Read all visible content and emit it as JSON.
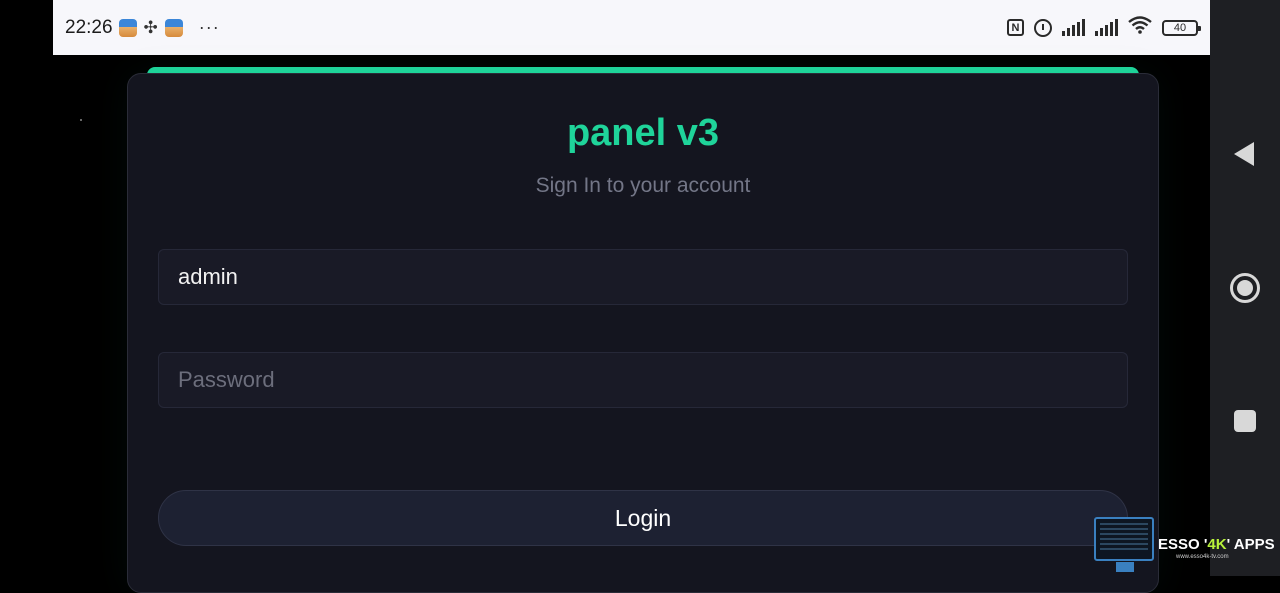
{
  "status_bar": {
    "time": "22:26",
    "more": "···",
    "battery": "40",
    "icons": [
      "notification-app-icon",
      "fan-icon",
      "notification-app-icon",
      "nfc-icon",
      "alarm-icon",
      "signal-icon",
      "signal-icon",
      "wifi-icon",
      "battery-icon"
    ]
  },
  "login": {
    "title": "panel v3",
    "subtitle": "Sign In to your account",
    "username_value": "admin",
    "password_placeholder": "Password",
    "login_label": "Login"
  },
  "colors": {
    "accent": "#1fd49a",
    "card_bg": "#14151f",
    "page_bg": "#000000"
  },
  "nav": {
    "icons": [
      "back-icon",
      "home-icon",
      "recents-icon"
    ]
  },
  "watermark": {
    "brand_prefix": "ESSO '",
    "brand_highlight": "4K",
    "brand_suffix": "' APPS",
    "url": "www.esso4k-tv.com"
  }
}
